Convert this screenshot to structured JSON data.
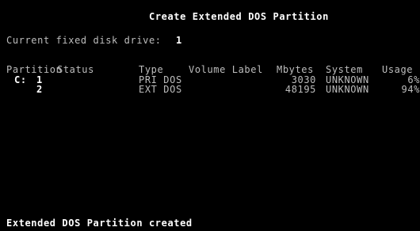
{
  "screen": {
    "title": "Create Extended DOS Partition",
    "drive_label": "Current fixed disk drive:",
    "drive_value": "1",
    "table": {
      "headers": {
        "partition": "Partition",
        "status": "Status",
        "type": "Type",
        "volume_label": "Volume Label",
        "mbytes": "Mbytes",
        "system": "System",
        "usage": "Usage"
      },
      "rows": [
        {
          "drive": "C:",
          "partition": "1",
          "status": "",
          "type": "PRI DOS",
          "volume_label": "",
          "mbytes": "3030",
          "system": "UNKNOWN",
          "usage": "6%"
        },
        {
          "drive": "",
          "partition": "2",
          "status": "",
          "type": "EXT DOS",
          "volume_label": "",
          "mbytes": "48195",
          "system": "UNKNOWN",
          "usage": "94%"
        }
      ]
    },
    "status_message": "Extended DOS Partition created"
  },
  "colors": {
    "background": "#000000",
    "text": "#bdbdbd",
    "highlight": "#ffffff"
  }
}
